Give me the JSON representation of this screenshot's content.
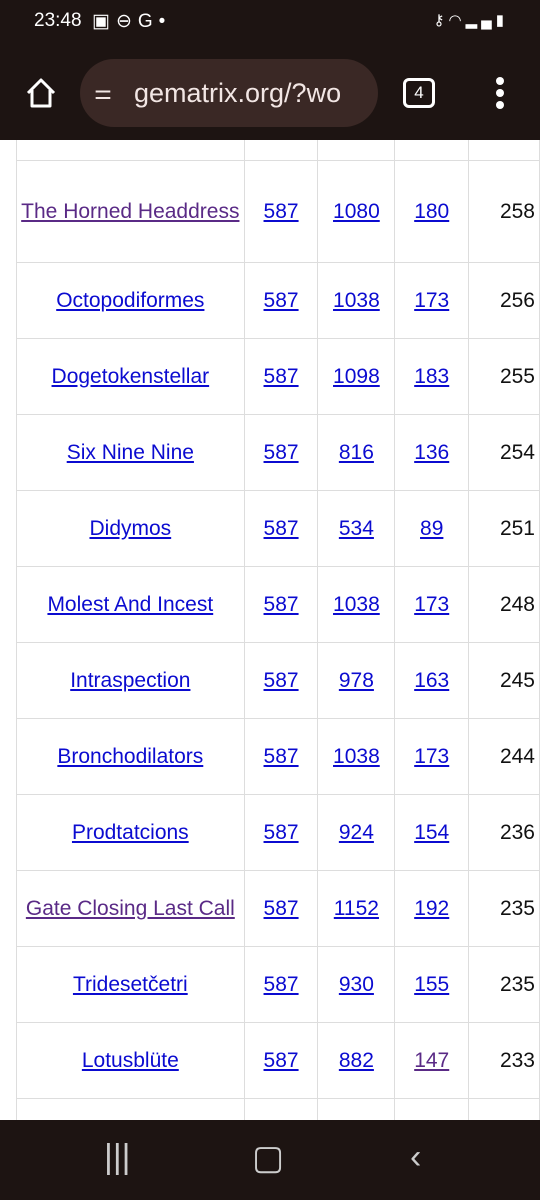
{
  "status_bar": {
    "time": "23:48",
    "left_icons": [
      "image-icon",
      "dnd-icon",
      "google-icon",
      "dot-icon"
    ],
    "right_icons": [
      "vpn-key-icon",
      "wifi-icon",
      "signal-icon",
      "battery-icon"
    ]
  },
  "browser": {
    "url": "gematrix.org/?wo",
    "tab_count": "4"
  },
  "table": {
    "rows": [
      {
        "word": "The Horned Headdress",
        "v1": "587",
        "v2": "1080",
        "v3": "180",
        "count": "258",
        "visited": true
      },
      {
        "word": "Octopodiformes",
        "v1": "587",
        "v2": "1038",
        "v3": "173",
        "count": "256"
      },
      {
        "word": "Dogetokenstellar",
        "v1": "587",
        "v2": "1098",
        "v3": "183",
        "count": "255"
      },
      {
        "word": "Six Nine Nine",
        "v1": "587",
        "v2": "816",
        "v3": "136",
        "count": "254"
      },
      {
        "word": "Didymos",
        "v1": "587",
        "v2": "534",
        "v3": "89",
        "count": "251"
      },
      {
        "word": "Molest And Incest",
        "v1": "587",
        "v2": "1038",
        "v3": "173",
        "count": "248"
      },
      {
        "word": "Intraspection",
        "v1": "587",
        "v2": "978",
        "v3": "163",
        "count": "245"
      },
      {
        "word": "Bronchodilators",
        "v1": "587",
        "v2": "1038",
        "v3": "173",
        "count": "244"
      },
      {
        "word": "Prodtatcions",
        "v1": "587",
        "v2": "924",
        "v3": "154",
        "count": "236"
      },
      {
        "word": "Gate Closing Last Call",
        "v1": "587",
        "v2": "1152",
        "v3": "192",
        "count": "235",
        "visited": true
      },
      {
        "word": "Tridesetčetri",
        "v1": "587",
        "v2": "930",
        "v3": "155",
        "count": "235"
      },
      {
        "word": "Lotusblüte",
        "v1": "587",
        "v2": "882",
        "v3": "147",
        "count": "233",
        "v3_visited": true
      }
    ]
  },
  "colors": {
    "link": "#0b0bd0",
    "visited": "#5a2a86",
    "chrome": "#1d1412"
  }
}
